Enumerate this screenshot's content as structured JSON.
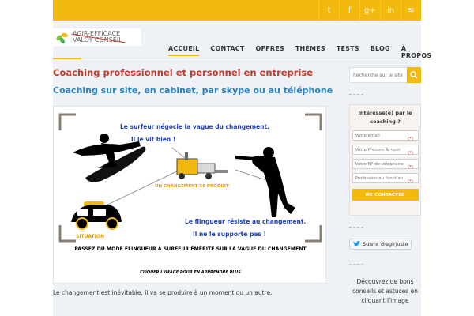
{
  "social": {
    "icons": [
      "twitter-icon",
      "facebook-icon",
      "google-plus-icon",
      "linkedin-icon",
      "rss-icon"
    ],
    "glyphs": [
      "t",
      "f",
      "g+",
      "in",
      "≋"
    ]
  },
  "logo": {
    "line1": "AGIR-EFFICACE",
    "line2": "VALOY CONSEIL"
  },
  "nav": {
    "items": [
      "ACCUEIL",
      "CONTACT",
      "OFFRES",
      "THÈMES",
      "TESTS",
      "BLOG",
      "À PROPOS"
    ],
    "active": "ACCUEIL"
  },
  "main": {
    "title": "Coaching professionnel et personnel en entreprise",
    "subtitle": "Coaching sur site, en cabinet, par skype ou au téléphone",
    "figure": {
      "surfer_line1": "Le surfeur négocie la vague du changement.",
      "surfer_line2": "Il le vit bien !",
      "change_label": "UN CHANGEMENT SE PRODUIT",
      "situation_label": "SITUATION",
      "shooter_line1": "Le flingueur résiste au changement.",
      "shooter_line2": "Il ne le supporte pas !",
      "banner": "PASSEZ DU MODE FLINGUEUR À SURFEUR ÉMÉRITE SUR LA VAGUE DU CHANGEMENT",
      "cta": "CLIQUER L'IMAGE POUR EN APPRENDRE PLUS"
    },
    "body_text": "Le changement est inévitable, il va se produire à un moment ou un autre."
  },
  "sidebar": {
    "search_placeholder": "Recherche sur le site",
    "form": {
      "title_line1": "Intéressé(e) par le",
      "title_line2": "coaching ?",
      "fields": [
        {
          "placeholder": "Votre email",
          "required": "(*)"
        },
        {
          "placeholder": "Votre Prénom & nom",
          "required": "(*)"
        },
        {
          "placeholder": "Votre N° de téléphone",
          "required": "(*)"
        },
        {
          "placeholder": "Profession ou fonction",
          "required": "(*)"
        }
      ],
      "button": "ME CONTACTER"
    },
    "follow_label": "Suivre @agirjuste",
    "promo_line1": "Découvrez de bons",
    "promo_line2": "conseils et astuces en",
    "promo_line3": "cliquant l'image"
  },
  "colors": {
    "accent": "#f2b90f",
    "title": "#c0392b",
    "subtitle": "#2980b9",
    "figure_blue": "#1f3fbf"
  }
}
